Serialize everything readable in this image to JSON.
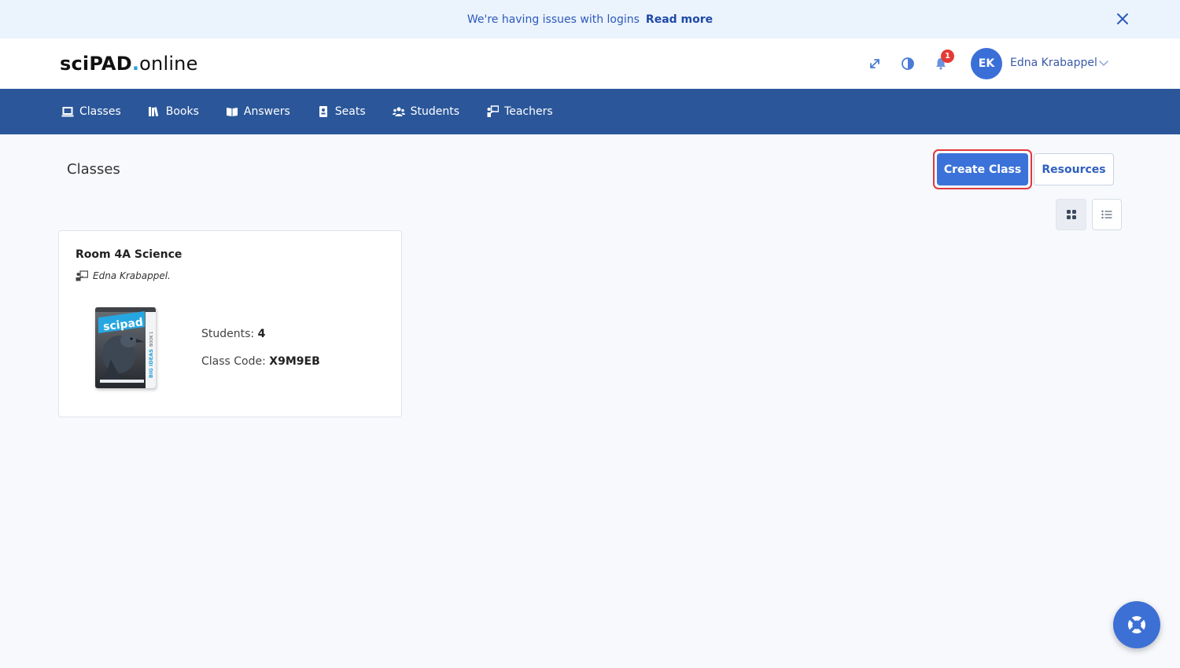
{
  "banner": {
    "message": "We're having issues with logins",
    "link_label": "Read more"
  },
  "header": {
    "logo": {
      "part1": "sciPAD",
      "dot": ".",
      "part2": "online"
    },
    "notifications_count": "1",
    "user": {
      "initials": "EK",
      "name": "Edna Krabappel"
    }
  },
  "nav": {
    "items": [
      {
        "label": "Classes",
        "icon": "classes-icon"
      },
      {
        "label": "Books",
        "icon": "books-icon"
      },
      {
        "label": "Answers",
        "icon": "answers-icon"
      },
      {
        "label": "Seats",
        "icon": "seats-icon"
      },
      {
        "label": "Students",
        "icon": "students-icon"
      },
      {
        "label": "Teachers",
        "icon": "teachers-icon"
      }
    ]
  },
  "page": {
    "title": "Classes",
    "create_button": "Create Class",
    "resources_button": "Resources"
  },
  "classes": [
    {
      "name": "Room 4A Science",
      "teacher": "Edna Krabappel.",
      "students_label": "Students:",
      "students_count": "4",
      "code_label": "Class Code:",
      "code": "X9M9EB",
      "book": {
        "brand": "scipad",
        "series": "BIG IDEAS",
        "volume": "BOOK 1"
      }
    }
  ],
  "colors": {
    "nav": "#2b579a",
    "accent": "#3b72d9",
    "highlight_ring": "#e0393e",
    "badge": "#e53935"
  }
}
